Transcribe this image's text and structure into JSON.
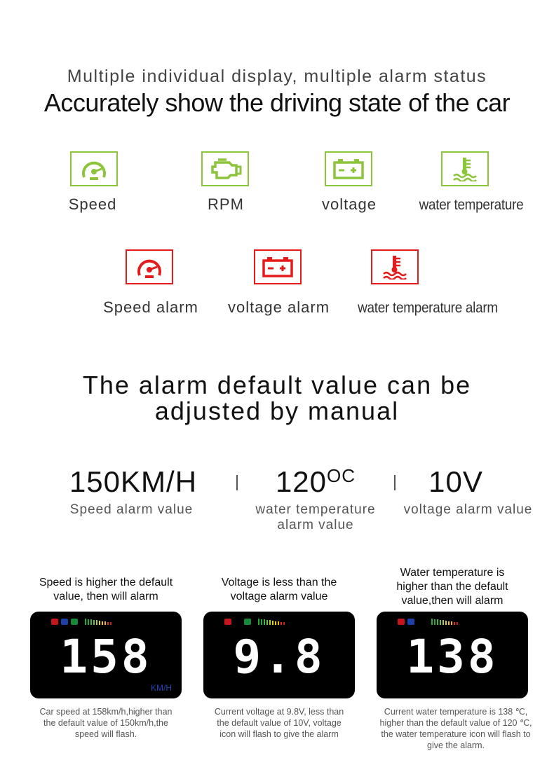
{
  "header": {
    "subtitle": "Multiple individual display, multiple alarm status",
    "title": "Accurately show the driving state of the car"
  },
  "colors": {
    "normal": "#8cc43a",
    "alarm": "#e51b1b",
    "kmh": "#2443b8"
  },
  "status_icons": [
    {
      "icon": "speedometer-icon",
      "label": "Speed"
    },
    {
      "icon": "engine-icon",
      "label": "RPM"
    },
    {
      "icon": "battery-icon",
      "label": "voltage"
    },
    {
      "icon": "water-temperature-icon",
      "label": "water temperature"
    }
  ],
  "alarm_icons": [
    {
      "icon": "speedometer-icon",
      "label": "Speed alarm"
    },
    {
      "icon": "battery-icon",
      "label": "voltage alarm"
    },
    {
      "icon": "water-temperature-icon",
      "label": "water temperature alarm"
    }
  ],
  "section2": {
    "line1": "The alarm default value can be",
    "line2": "adjusted by manual"
  },
  "defaults": [
    {
      "value": "150KM/H",
      "label": "Speed alarm value"
    },
    {
      "value": "120",
      "unit": "OC",
      "label1": "water temperature",
      "label2": "alarm value"
    },
    {
      "value": "10V",
      "label": "voltage alarm value"
    }
  ],
  "examples": [
    {
      "caption1": "Speed is higher the default",
      "caption2": "value, then will alarm",
      "reading": "158",
      "unit": "KM/H",
      "desc1": "Car speed at 158km/h,higher than",
      "desc2": "the default value of 150km/h,the",
      "desc3": "speed will flash."
    },
    {
      "caption1": "Voltage is less than the",
      "caption2": "voltage alarm value",
      "reading": "9.8",
      "desc1": "Current voltage at 9.8V, less than",
      "desc2": "the default value of 10V, voltage",
      "desc3": "icon will flash to give the alarm"
    },
    {
      "caption0": "Water temperature is",
      "caption1": "higher than the default",
      "caption2": "value,then will alarm",
      "reading": "138",
      "desc1": "Current water temperature is 138 ℃,",
      "desc2": "higher than the default value of 120 ℃,",
      "desc3": "the water temperature icon will flash to",
      "desc4": "give the alarm."
    }
  ]
}
